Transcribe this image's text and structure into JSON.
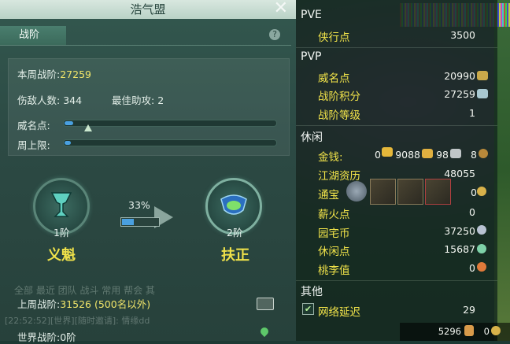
{
  "window": {
    "title": "浩气盟"
  },
  "tabs": {
    "active": "战阶"
  },
  "week": {
    "label": "本周战阶:",
    "value": "27259",
    "kills_label": "伤敌人数:",
    "kills_value": "344",
    "assist_label": "最佳助攻:",
    "assist_value": "2",
    "prestige_label": "威名点:",
    "prestige_progress": 0.04,
    "weekly_cap_label": "周上限:",
    "weekly_cap_progress": 0.03
  },
  "tiers": {
    "current": {
      "level": "1阶",
      "name": "义魁"
    },
    "next": {
      "level": "2阶",
      "name": "扶正"
    },
    "progress_label": "33%",
    "progress": 0.33
  },
  "last_week": {
    "label": "上周战阶:",
    "value": "31526 (500名以外)"
  },
  "world": {
    "label": "世界战阶:",
    "value": "0阶"
  },
  "chat_bg": {
    "tabs": "全部   最近   团队   战斗   常用   帮会   其",
    "line": "[22:52:52][世界][随时邀请]: 情缘dd"
  },
  "stats": {
    "pve_header": "PVE",
    "pve": [
      {
        "label": "侠行点",
        "value": "3500"
      }
    ],
    "pvp_header": "PVP",
    "pvp": [
      {
        "label": "威名点",
        "value": "20990"
      },
      {
        "label": "战阶积分",
        "value": "27259"
      },
      {
        "label": "战阶等级",
        "value": "1"
      }
    ],
    "leisure_header": "休闲",
    "money": {
      "label": "金钱:",
      "a": "0",
      "b": "9088",
      "c": "98",
      "d": "8"
    },
    "leisure": [
      {
        "label": "江湖资历",
        "value": "48055"
      },
      {
        "label": "通宝",
        "value": "0"
      },
      {
        "label": "薪火点",
        "value": "0"
      },
      {
        "label": "园宅币",
        "value": "37250"
      },
      {
        "label": "休闲点",
        "value": "15687"
      },
      {
        "label": "桃李值",
        "value": "0"
      }
    ],
    "other_header": "其他",
    "network_label": "网络延迟",
    "network_value": "29"
  },
  "bottom": {
    "a": "5296",
    "b": "0"
  },
  "colors": {
    "accent_yellow": "#f2e44a",
    "progress_blue": "#4aa0e0"
  }
}
